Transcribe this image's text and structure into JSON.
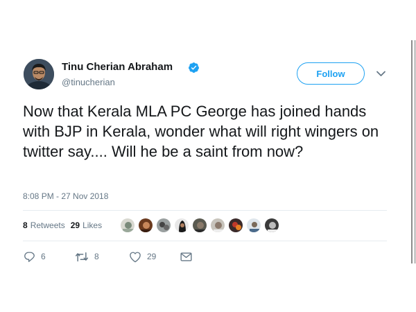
{
  "user": {
    "name": "Tinu Cherian Abraham",
    "handle": "@tinucherian",
    "verified_icon": "verified-badge-icon"
  },
  "header": {
    "follow_label": "Follow",
    "menu_icon": "chevron-down-icon"
  },
  "tweet": {
    "text": "Now that Kerala MLA PC George has joined hands with BJP in Kerala, wonder what will right wingers on twitter say.... Will he be a saint from now?",
    "timestamp": "8:08 PM - 27 Nov 2018"
  },
  "stats": {
    "retweets_count": "8",
    "retweets_label": "Retweets",
    "likes_count": "29",
    "likes_label": "Likes"
  },
  "actions": {
    "replies": "6",
    "retweets": "8",
    "likes": "29"
  },
  "colors": {
    "accent": "#1da1f2",
    "text": "#14171a",
    "muted": "#657786",
    "divider": "#e6ecf0"
  }
}
